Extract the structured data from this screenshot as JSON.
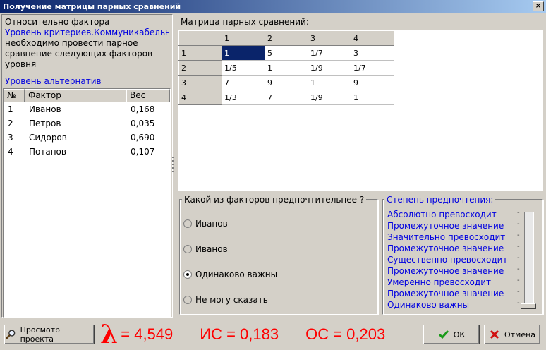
{
  "window": {
    "title": "Получение матрицы парных сравнений",
    "close_label": "×"
  },
  "info": {
    "line1": "Относительно фактора",
    "criteria_link": "Уровень критериев.Коммуникабельность",
    "text": "необходимо провести парное сравнение следующих факторов уровня",
    "alt_level_link": "Уровень альтернатив"
  },
  "factor_table": {
    "headers": [
      "№",
      "Фактор",
      "Вес"
    ],
    "rows": [
      {
        "no": "1",
        "name": "Иванов",
        "weight": "0,168"
      },
      {
        "no": "2",
        "name": "Петров",
        "weight": "0,035"
      },
      {
        "no": "3",
        "name": "Сидоров",
        "weight": "0,690"
      },
      {
        "no": "4",
        "name": "Потапов",
        "weight": "0,107"
      }
    ]
  },
  "matrix": {
    "label": "Матрица парных сравнений:",
    "col_headers": [
      "1",
      "2",
      "3",
      "4"
    ],
    "rows": [
      {
        "header": "1",
        "cells": [
          "1",
          "5",
          "1/7",
          "3"
        ]
      },
      {
        "header": "2",
        "cells": [
          "1/5",
          "1",
          "1/9",
          "1/7"
        ]
      },
      {
        "header": "3",
        "cells": [
          "7",
          "9",
          "1",
          "9"
        ]
      },
      {
        "header": "4",
        "cells": [
          "1/3",
          "7",
          "1/9",
          "1"
        ]
      }
    ],
    "selected": {
      "row": 0,
      "col": 0
    }
  },
  "question": {
    "title": "Какой из факторов предпочтительнее ?",
    "options": [
      "Иванов",
      "Иванов",
      "Одинаково важны",
      "Не могу сказать"
    ],
    "selected_index": 2
  },
  "degree": {
    "title": "Степень предпочтения:",
    "items": [
      "Абсолютно превосходит",
      "Промежуточное значение",
      "Значительно превосходит",
      "Промежуточное значение",
      "Существенно превосходит",
      "Промежуточное значение",
      "Умеренно превосходит",
      "Промежуточное значение",
      "Одинаково важны"
    ],
    "dash": "-",
    "slider_position": "Одинаково важны"
  },
  "bottom": {
    "view_button": "Просмотр проекта",
    "lambda_symbol": "λ",
    "lambda_value": "= 4,549",
    "ic": "ИС = 0,183",
    "oc": "ОС = 0,203",
    "ok_button": "ОК",
    "cancel_button": "Отмена"
  },
  "colors": {
    "link": "#0000e0",
    "stats": "#ff0000",
    "titlebar": "#0a246a",
    "selection": "#0a246a"
  }
}
